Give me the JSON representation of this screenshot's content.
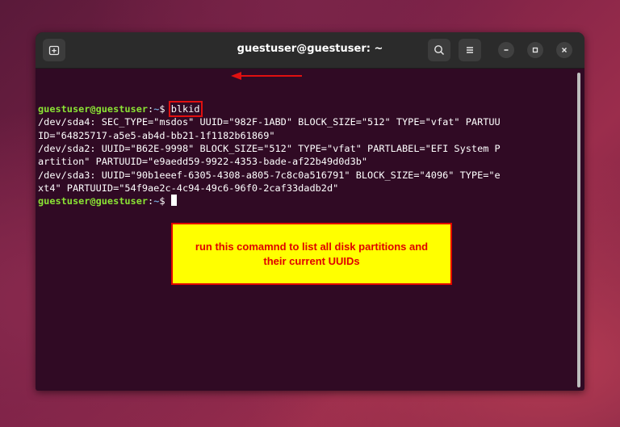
{
  "window": {
    "title": "guestuser@guestuser: ~"
  },
  "titlebar": {
    "new_tab_icon": "new-tab-icon",
    "search_icon": "search-icon",
    "menu_icon": "hamburger-menu-icon",
    "minimize_icon": "minimize-icon",
    "maximize_icon": "maximize-icon",
    "close_icon": "close-icon"
  },
  "terminal": {
    "prompt_user": "guestuser@guestuser",
    "prompt_sep": ":",
    "prompt_path": "~",
    "prompt_symbol": "$ ",
    "command": "blkid",
    "output_lines": [
      "/dev/sda4: SEC_TYPE=\"msdos\" UUID=\"982F-1ABD\" BLOCK_SIZE=\"512\" TYPE=\"vfat\" PARTUU",
      "ID=\"64825717-a5e5-ab4d-bb21-1f1182b61869\"",
      "/dev/sda2: UUID=\"B62E-9998\" BLOCK_SIZE=\"512\" TYPE=\"vfat\" PARTLABEL=\"EFI System P",
      "artition\" PARTUUID=\"e9aedd59-9922-4353-bade-af22b49d0d3b\"",
      "/dev/sda3: UUID=\"90b1eeef-6305-4308-a805-7c8c0a516791\" BLOCK_SIZE=\"4096\" TYPE=\"e",
      "xt4\" PARTUUID=\"54f9ae2c-4c94-49c6-96f0-2caf33dadb2d\""
    ]
  },
  "annotation": {
    "line1": "run this comamnd to list all disk partitions and",
    "line2": "their current UUIDs",
    "color_fill": "#ffff00",
    "color_text": "#e00000"
  },
  "colors": {
    "terminal_bg": "#300a24",
    "prompt_user": "#8ae234",
    "prompt_path": "#729fcf",
    "highlight": "#e01010"
  }
}
